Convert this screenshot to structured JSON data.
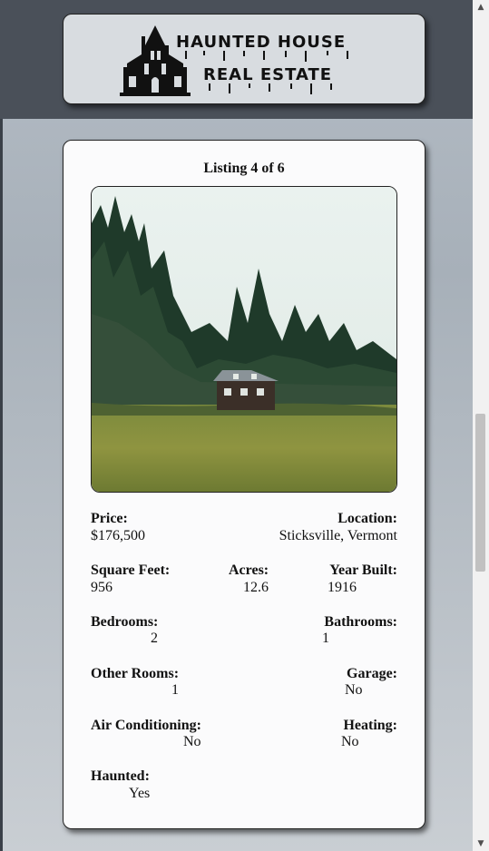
{
  "logo": {
    "line1": "HAUNTED HOUSE",
    "line2": "REAL ESTATE",
    "icon": "haunted-house-icon"
  },
  "listing": {
    "counter": "Listing 4 of 6",
    "photo_icon": "house-in-forest-photo",
    "price_label": "Price:",
    "price": "$176,500",
    "location_label": "Location:",
    "location": "Sticksville, Vermont",
    "sqft_label": "Square Feet:",
    "sqft": "956",
    "acres_label": "Acres:",
    "acres": "12.6",
    "year_label": "Year Built:",
    "year": "1916",
    "bedrooms_label": "Bedrooms:",
    "bedrooms": "2",
    "bathrooms_label": "Bathrooms:",
    "bathrooms": "1",
    "other_rooms_label": "Other Rooms:",
    "other_rooms": "1",
    "garage_label": "Garage:",
    "garage": "No",
    "ac_label": "Air Conditioning:",
    "ac": "No",
    "heating_label": "Heating:",
    "heating": "No",
    "haunted_label": "Haunted:",
    "haunted": "Yes"
  },
  "scrollbar": {
    "up_icon": "arrow-up-icon",
    "down_icon": "arrow-down-icon",
    "up_glyph": "▲",
    "down_glyph": "▼"
  }
}
